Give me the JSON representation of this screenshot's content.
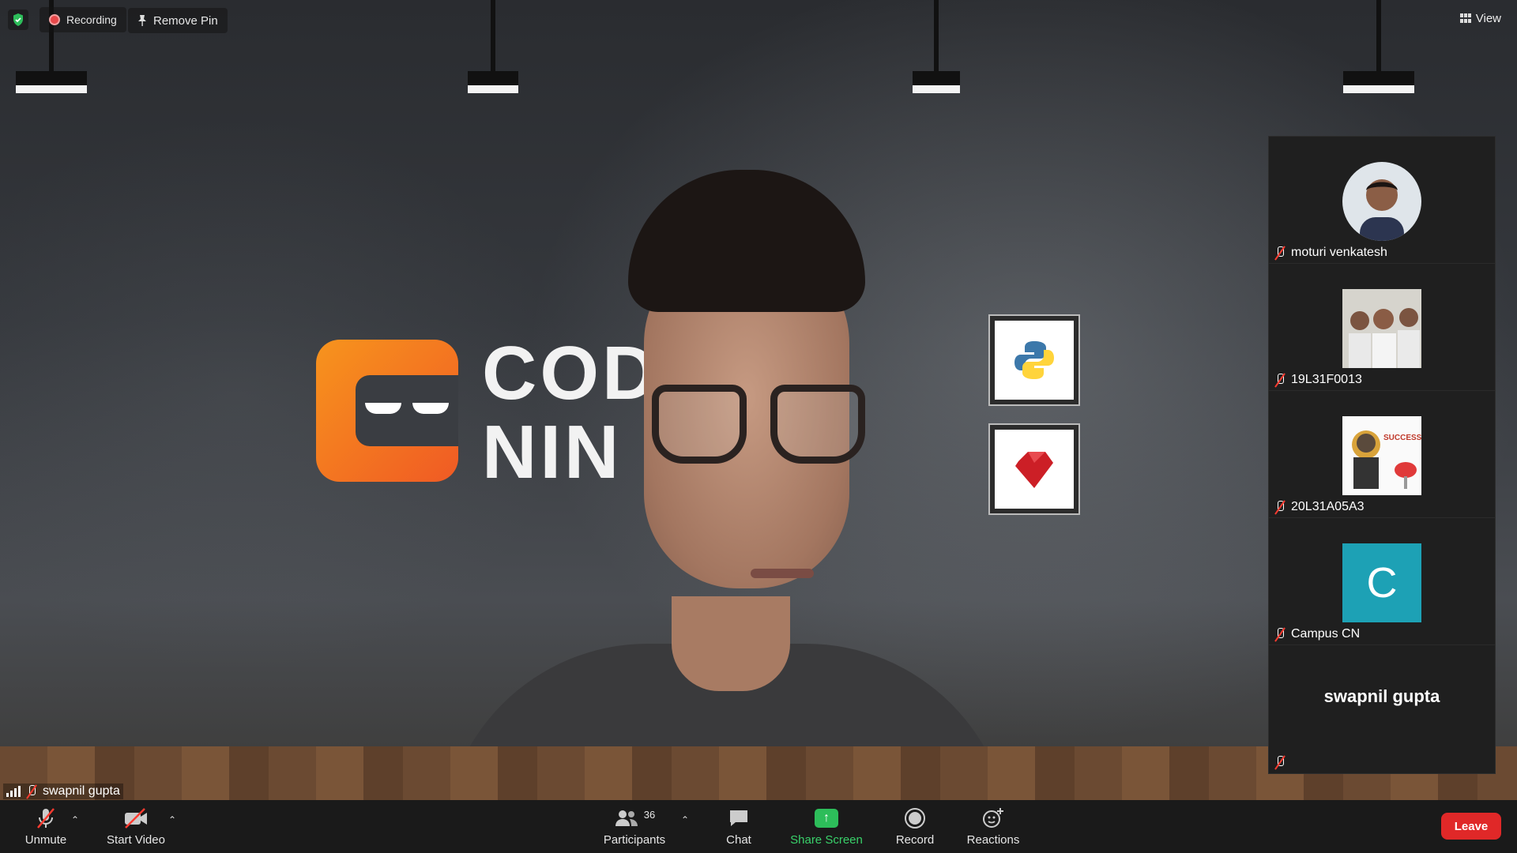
{
  "top_bar": {
    "recording_label": "Recording",
    "remove_pin_label": "Remove Pin",
    "view_label": "View"
  },
  "background": {
    "brand_line1": "COD",
    "brand_line2": "NIN"
  },
  "gallery": {
    "participants": [
      {
        "name": "moturi venkatesh",
        "avatar": "photo",
        "muted": true
      },
      {
        "name": "19L31F0013",
        "avatar": "group-photo",
        "muted": true
      },
      {
        "name": "20L31A05A3",
        "avatar": "success-poster",
        "muted": true
      },
      {
        "name": "Campus CN",
        "avatar_letter": "C",
        "avatar_color": "#1da1b5",
        "muted": true
      },
      {
        "name": "swapnil gupta",
        "avatar": "name-only",
        "muted": true
      }
    ],
    "poster_text": "SUCCESS"
  },
  "self_view": {
    "name": "swapnil gupta"
  },
  "toolbar": {
    "unmute_label": "Unmute",
    "start_video_label": "Start Video",
    "participants_label": "Participants",
    "participants_count": "36",
    "chat_label": "Chat",
    "share_screen_label": "Share Screen",
    "record_label": "Record",
    "reactions_label": "Reactions",
    "leave_label": "Leave"
  },
  "colors": {
    "leave": "#e02828",
    "share_screen": "#2dbd5a",
    "recording_dot": "#e8484a",
    "muted_slash": "#ff3b30"
  }
}
